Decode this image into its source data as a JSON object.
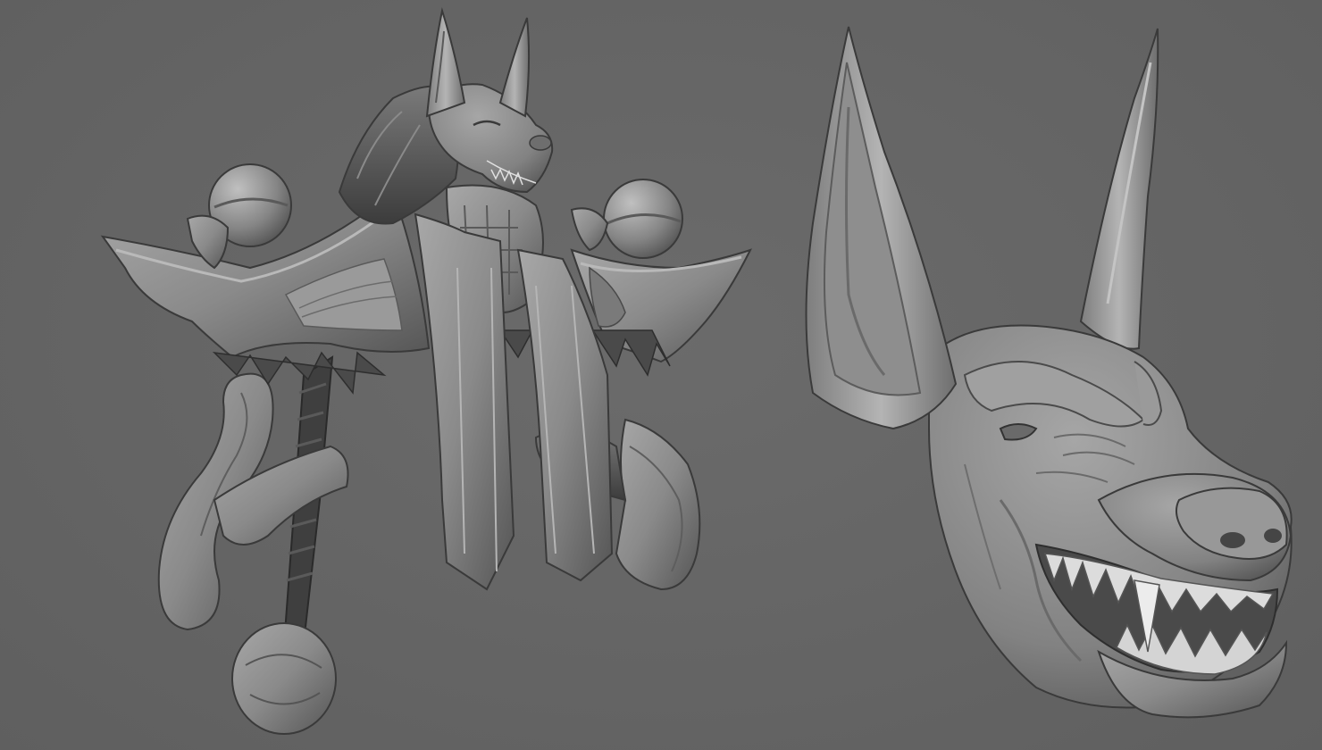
{
  "scene": {
    "background_color": "#666666",
    "clay_color": "#8a8a8a",
    "models": [
      {
        "id": "anubis-armor-rig",
        "kind": "sculpt"
      },
      {
        "id": "anubis-head-sculpt",
        "kind": "sculpt"
      }
    ]
  }
}
